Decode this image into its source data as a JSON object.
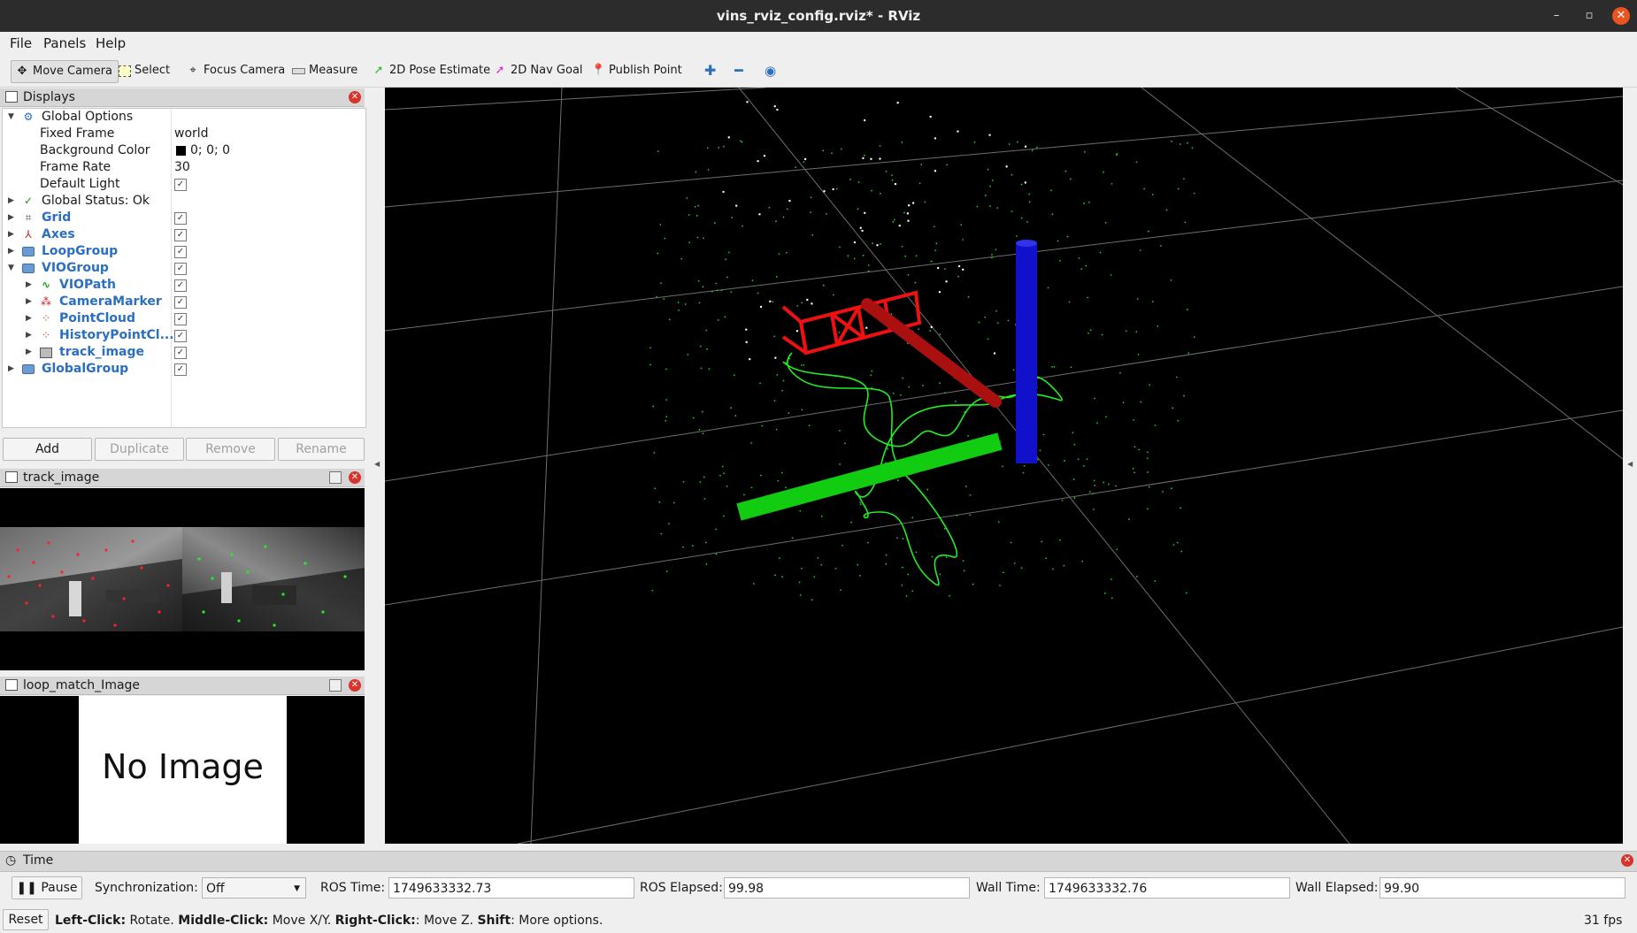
{
  "window": {
    "title": "vins_rviz_config.rviz* - RViz",
    "min_glyph": "–",
    "max_glyph": "▫",
    "close_glyph": "✕"
  },
  "menu": {
    "file": "File",
    "panels": "Panels",
    "help": "Help"
  },
  "toolbar": {
    "tools": [
      {
        "label": "Move Camera",
        "icon": "move-camera-icon"
      },
      {
        "label": "Select",
        "icon": "select-icon"
      },
      {
        "label": "Focus Camera",
        "icon": "focus-camera-icon"
      },
      {
        "label": "Measure",
        "icon": "measure-icon"
      },
      {
        "label": "2D Pose Estimate",
        "icon": "pose-estimate-icon"
      },
      {
        "label": "2D Nav Goal",
        "icon": "nav-goal-icon"
      },
      {
        "label": "Publish Point",
        "icon": "publish-point-icon"
      }
    ],
    "extra_icons": [
      "add-tool-icon",
      "remove-tool-icon",
      "view-eye-icon"
    ]
  },
  "displays": {
    "title": "Displays",
    "global_options": {
      "label": "Global Options",
      "fixed_frame": {
        "label": "Fixed Frame",
        "value": "world"
      },
      "background_color": {
        "label": "Background Color",
        "value": "0; 0; 0",
        "swatch": "#000000"
      },
      "frame_rate": {
        "label": "Frame Rate",
        "value": "30"
      },
      "default_light": {
        "label": "Default Light",
        "checked": true
      }
    },
    "global_status": "Global Status: Ok",
    "items": [
      {
        "label": "Grid",
        "checked": true
      },
      {
        "label": "Axes",
        "checked": true
      },
      {
        "label": "LoopGroup",
        "checked": true
      },
      {
        "label": "VIOGroup",
        "checked": true
      },
      {
        "label": "VIOPath",
        "checked": true
      },
      {
        "label": "CameraMarker",
        "checked": true
      },
      {
        "label": "PointCloud",
        "checked": true
      },
      {
        "label": "HistoryPointCl...",
        "checked": true
      },
      {
        "label": "track_image",
        "checked": true
      },
      {
        "label": "GlobalGroup",
        "checked": true
      }
    ],
    "buttons": {
      "add": "Add",
      "duplicate": "Duplicate",
      "remove": "Remove",
      "rename": "Rename"
    }
  },
  "track_image_panel": {
    "title": "track_image"
  },
  "loop_panel": {
    "title": "loop_match_Image",
    "placeholder": "No Image"
  },
  "time_panel": {
    "title": "Time",
    "pause": "Pause",
    "sync_label": "Synchronization:",
    "sync_value": "Off",
    "ros_time_label": "ROS Time:",
    "ros_time": "1749633332.73",
    "ros_elapsed_label": "ROS Elapsed:",
    "ros_elapsed": "99.98",
    "wall_time_label": "Wall Time:",
    "wall_time": "1749633332.76",
    "wall_elapsed_label": "Wall Elapsed:",
    "wall_elapsed": "99.90"
  },
  "status": {
    "reset": "Reset",
    "left_click_key": "Left-Click:",
    "left_click_text": " Rotate. ",
    "middle_click_key": "Middle-Click:",
    "middle_click_text": " Move X/Y. ",
    "right_click_key": "Right-Click:",
    "right_click_text": ": Move Z. ",
    "shift_key": "Shift",
    "shift_text": ": More options.",
    "fps": "31 fps"
  },
  "colors": {
    "axis_x": "#11cc11",
    "axis_y": "#cc1111",
    "axis_z": "#1111cc",
    "path": "#22ee22",
    "camera_marker": "#ee1111"
  }
}
